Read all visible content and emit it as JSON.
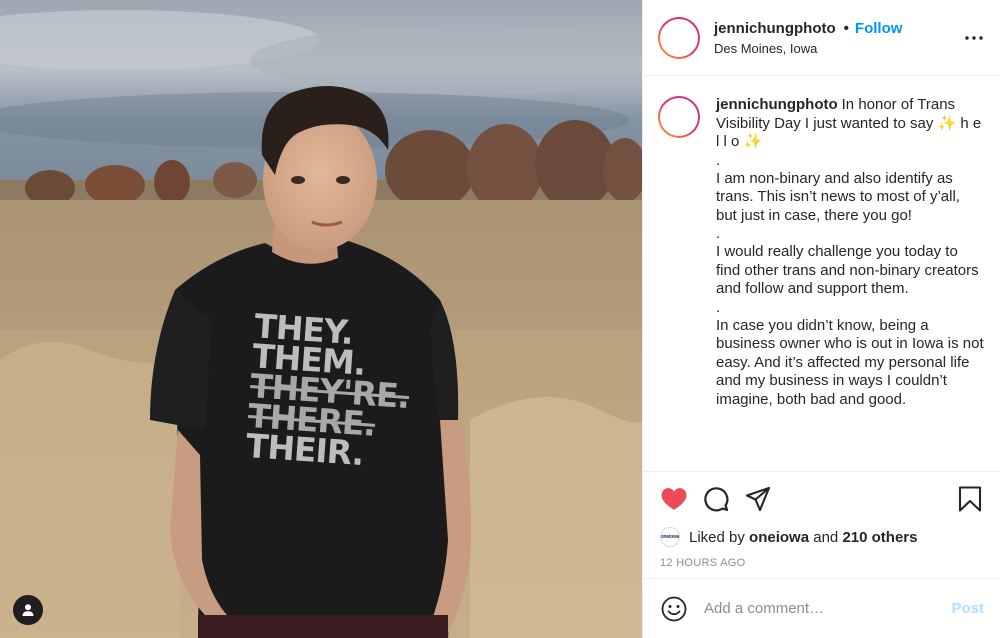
{
  "post": {
    "username": "jennichungphoto",
    "follow_label": "Follow",
    "separator": "•",
    "location": "Des Moines, Iowa",
    "more_icon": "more-horizontal-icon"
  },
  "photo": {
    "shirt_lines": [
      "THEY.",
      "THEM.",
      "THEY'RE.",
      "THERE.",
      "THEIR."
    ]
  },
  "caption": {
    "username": "jennichungphoto",
    "paragraphs": [
      "In honor of Trans Visibility Day I just wanted to say ✨ h e l l o ✨",
      ".",
      "I am non-binary and also identify as trans. This isn’t news to most of y’all, but just in case, there you go!",
      ".",
      "I would really challenge you today to find other trans and non-binary creators and follow and support them.",
      ".",
      "In case you didn’t know, being a business owner who is out in Iowa is not easy. And it’s affected my personal life and my business in ways I couldn’t imagine, both bad and good."
    ]
  },
  "actions": {
    "like_icon": "heart-filled-icon",
    "comment_icon": "comment-icon",
    "share_icon": "paper-plane-icon",
    "save_icon": "bookmark-icon",
    "like_color": "#ed4956"
  },
  "likes": {
    "prefix": "Liked by",
    "liker": "oneiowa",
    "liker_avatar_text": "oneiowa",
    "conjunction": "and",
    "others": "210 others"
  },
  "timestamp": "12 HOURS AGO",
  "comment_box": {
    "placeholder": "Add a comment…",
    "post_label": "Post"
  }
}
